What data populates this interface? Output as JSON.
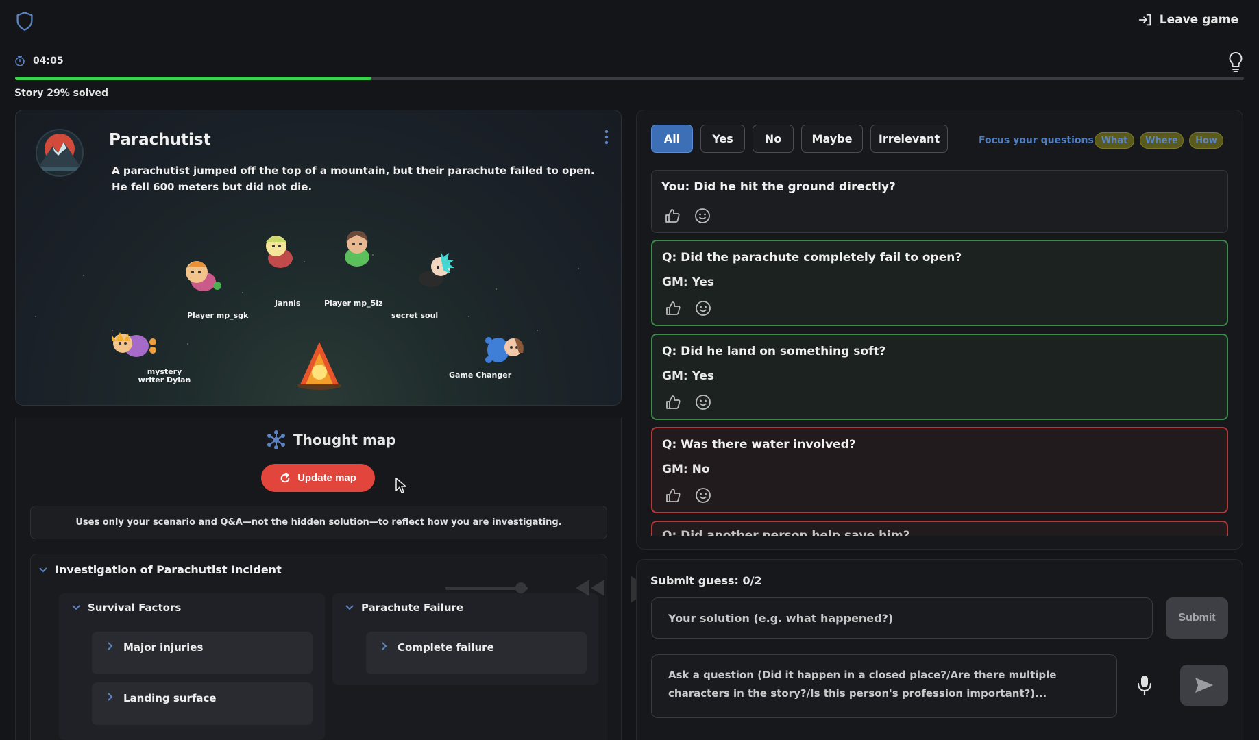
{
  "header": {
    "leave_label": "Leave game",
    "timer": "04:05",
    "progress_percent": 29,
    "progress_text": "Story 29% solved"
  },
  "story": {
    "title": "Parachutist",
    "text": "A parachutist jumped off the top of a mountain, but their parachute failed to open. He fell 600 meters but did not die.",
    "players": [
      "Player mp_sgk",
      "Jannis",
      "Player mp_5iz",
      "secret soul",
      "mystery writer Dylan",
      "Game Changer"
    ]
  },
  "thought_map": {
    "title": "Thought map",
    "update_label": "Update map",
    "note": "Uses only your scenario and Q&A—not the hidden solution—to reflect how you are investigating.",
    "root": "Investigation of Parachutist Incident",
    "branches": [
      {
        "label": "Survival Factors",
        "children": [
          "Major injuries",
          "Landing surface"
        ]
      },
      {
        "label": "Parachute Failure",
        "children": [
          "Complete failure"
        ]
      }
    ]
  },
  "qa": {
    "filters": [
      "All",
      "Yes",
      "No",
      "Maybe",
      "Irrelevant"
    ],
    "active_filter": "All",
    "focus_label": "Focus your questions on:",
    "focus_chips": [
      "What",
      "Where",
      "How"
    ],
    "items": [
      {
        "question": "You: Did he hit the ground directly?",
        "answer": "",
        "status": "pending"
      },
      {
        "question": "Q: Did the parachute completely fail to open?",
        "answer": "GM: Yes",
        "status": "yes"
      },
      {
        "question": "Q: Did he land on something soft?",
        "answer": "GM: Yes",
        "status": "yes"
      },
      {
        "question": "Q: Was there water involved?",
        "answer": "GM: No",
        "status": "no"
      },
      {
        "question": "Q: Did another person help save him?",
        "answer": "",
        "status": "no"
      }
    ]
  },
  "guess": {
    "label": "Submit guess: 0/2",
    "solution_placeholder": "Your solution (e.g. what happened?)",
    "submit_label": "Submit",
    "question_placeholder": "Ask a question (Did it happen in a closed place?/Are there multiple characters in the story?/Is this person's profession important?)..."
  },
  "colors": {
    "accent_blue": "#3c6fb5",
    "progress_green": "#3fcf4f",
    "update_red": "#e2453c",
    "yes_border": "#3e8a4c",
    "no_border": "#b23a3a"
  }
}
